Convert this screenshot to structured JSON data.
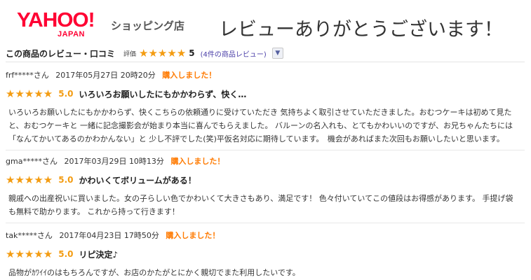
{
  "header": {
    "logo_text": "YAHOO!",
    "logo_sub": "JAPAN",
    "shop_label": "ショッピング店",
    "thanks": "レビューありがとうございます！"
  },
  "summary": {
    "title": "この商品のレビュー・口コミ",
    "rating_label": "評価",
    "stars": "★★★★★",
    "rating_value": 5,
    "score": "5",
    "count_text": "(4件の商品レビュー)"
  },
  "colors": {
    "logo_red": "#ff0033",
    "star": "#f39c12",
    "bought": "#ff7a00",
    "link": "#4b3fa8"
  },
  "reviews": [
    {
      "user": "frf*****さん",
      "datetime": "2017年05月27日 20時20分",
      "bought_label": "購入しました！",
      "stars": "★★★★★",
      "rating_value": 5,
      "score": "5.0",
      "title": "いろいろお願いしたにもかかわらず、快く…",
      "body": "いろいろお願いしたにもかかわらず、快くこちらの依頼通りに受けていただき 気持ちよく取引させていただきました。おむつケーキは初めて見たと、おむつケーキと 一緒に記念撮影会が始まり本当に喜んでもらえました。 バルーンの名入れも、とてもかわいいのですが、お兄ちゃんたちには「なんてかいてあるのかわかんない」と 少し不評でした(笑)平仮名対応に期待しています。　機会があればまた次回もお願いしたいと思います。"
    },
    {
      "user": "gma*****さん",
      "datetime": "2017年03月29日 10時13分",
      "bought_label": "購入しました！",
      "stars": "★★★★★",
      "rating_value": 5,
      "score": "5.0",
      "title": "かわいくてボリュームがある！",
      "body": "親戚への出産祝いに買いました。女の子らしい色でかわいくて大きさもあり、満足です！ 色々付いていてこの値段はお得感があります。 手提げ袋も無料で助かります。 これから持って行きます！"
    },
    {
      "user": "tak*****さん",
      "datetime": "2017年04月23日 17時50分",
      "bought_label": "購入しました！",
      "stars": "★★★★★",
      "rating_value": 5,
      "score": "5.0",
      "title": "リピ決定♪",
      "body": "品物がｶﾜｲｲのはもちろんですが、お店のかたがとにかく親切でまた利用したいです。"
    }
  ]
}
